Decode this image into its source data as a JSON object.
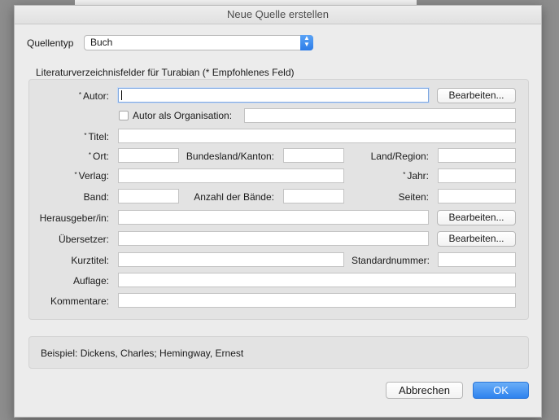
{
  "dialog": {
    "title": "Neue Quelle erstellen"
  },
  "source_type": {
    "label": "Quellentyp",
    "value": "Buch"
  },
  "group_title": "Literaturverzeichnisfelder für Turabian (* Empfohlenes Feld)",
  "required_marker": "*",
  "fields": {
    "author": "Autor:",
    "author_org": "Autor als Organisation:",
    "title": "Titel:",
    "place": "Ort:",
    "state": "Bundesland/Kanton:",
    "country": "Land/Region:",
    "publisher": "Verlag:",
    "year": "Jahr:",
    "volume": "Band:",
    "num_volumes": "Anzahl der Bände:",
    "pages": "Seiten:",
    "editor": "Herausgeber/in:",
    "translator": "Übersetzer:",
    "short_title": "Kurztitel:",
    "standard_number": "Standardnummer:",
    "edition": "Auflage:",
    "comments": "Kommentare:"
  },
  "edit_button": "Bearbeiten...",
  "example": "Beispiel: Dickens, Charles; Hemingway, Ernest",
  "buttons": {
    "cancel": "Abbrechen",
    "ok": "OK"
  },
  "colors": {
    "accent": "#2e82ee",
    "dialog_bg": "#ececec",
    "group_bg": "#e3e3e3"
  }
}
